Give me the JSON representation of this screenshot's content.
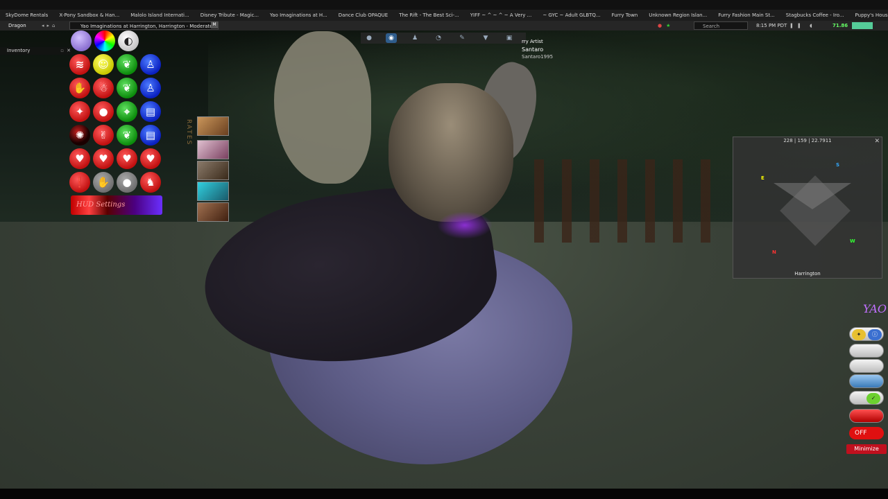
{
  "bookmarks": [
    "SkyDome Rentals",
    "X-Pony Sandbox & Han...",
    "Malolo Island Internati...",
    "Disney Tribute - Magic...",
    "Yao Imaginations at H...",
    "Dance Club OPAQUE",
    "The Rift - The Best Sci-...",
    "YIFF ~ ^ ~ ^ ~ A Very ...",
    "~ GYC ~ Adult GLBTQ...",
    "Furry Town",
    "Unknown Region Islan...",
    "Furry Fashion Main St...",
    "Stagbucks Coffee - Iro...",
    "Puppy's House & Ocul..."
  ],
  "nav": {
    "menu_label": "Dragon",
    "location": "Yao Imaginations at Harrington, Harrington - Moderate",
    "maturity_badge": "M",
    "search_placeholder": "Search",
    "clock": "8:15 PM PDT",
    "fps": "71.86"
  },
  "inventory": {
    "label": "Inventory"
  },
  "hud": {
    "settings_label": "HUD Settings"
  },
  "nametag": {
    "line1": "rry Artist",
    "line2": "Santaro",
    "line3": "Santaro1995"
  },
  "minimap": {
    "coords": "228 | 159 | 22.7911",
    "region": "Harrington",
    "compass": {
      "n": "N",
      "e": "E",
      "s": "S",
      "w": "W"
    }
  },
  "right_hud": {
    "logo": "YAO",
    "off_label": "OFF",
    "minimize_label": "Minimize"
  },
  "signpost": "RATES",
  "icons": {
    "navbar": [
      "back-icon",
      "forward-icon",
      "home-icon"
    ],
    "toolbar": [
      "microphone-icon",
      "chat-icon",
      "people-icon",
      "places-icon",
      "pin-icon",
      "appearance-icon",
      "inventory-icon"
    ]
  },
  "colors": {
    "accent_blue": "#2f5d8c",
    "fps_green": "#66ff66",
    "minimize_red": "#c0101e"
  }
}
